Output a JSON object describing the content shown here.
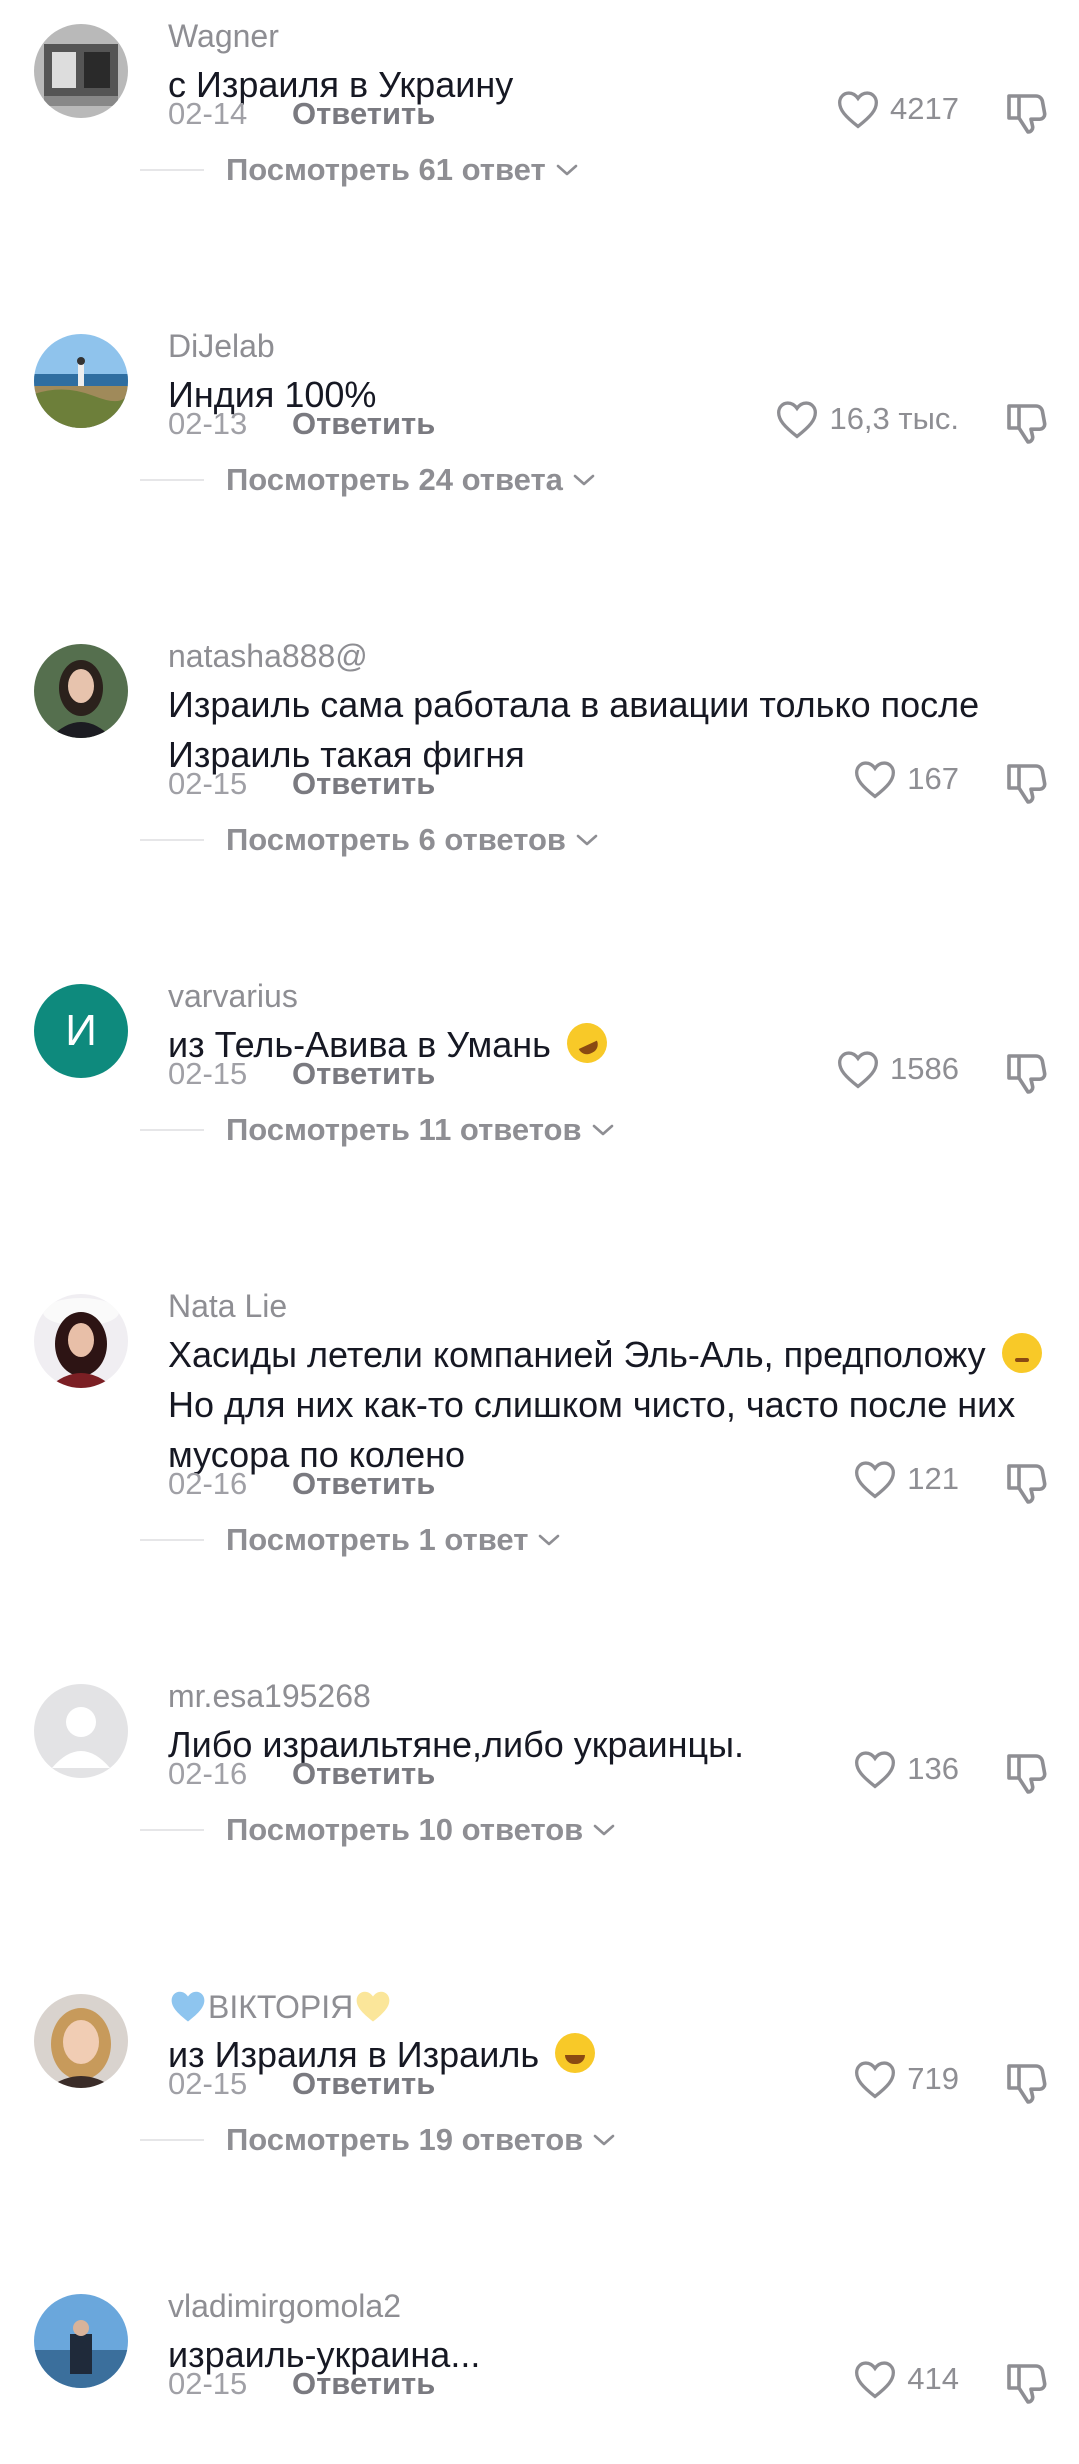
{
  "comments": [
    {
      "username": "Wagner",
      "text": "с Израиля в Украину",
      "date": "02-14",
      "reply_label": "Ответить",
      "likes": "4217",
      "view_replies": "Посмотреть 61 ответ"
    },
    {
      "username": "DiJelab",
      "text": "Индия 100%",
      "date": "02-13",
      "reply_label": "Ответить",
      "likes": "16,3 тыс.",
      "view_replies": "Посмотреть 24 ответа"
    },
    {
      "username": "natasha888@",
      "text": "Израиль сама работала в авиации только после Израиль такая фигня",
      "date": "02-15",
      "reply_label": "Ответить",
      "likes": "167",
      "view_replies": "Посмотреть 6 ответов"
    },
    {
      "username": "varvarius",
      "avatar_letter": "И",
      "text": "из Тель-Авива в Умань",
      "date": "02-15",
      "reply_label": "Ответить",
      "likes": "1586",
      "view_replies": "Посмотреть 11 ответов"
    },
    {
      "username": "Nata Lie",
      "text": "Хасиды летели компанией Эль-Аль, предположу",
      "text2": "Но для них как-то слишком чисто, часто после них мусора по колено",
      "date": "02-16",
      "reply_label": "Ответить",
      "likes": "121",
      "view_replies": "Посмотреть 1 ответ"
    },
    {
      "username": "mr.esa195268",
      "text": "Либо израильтяне,либо украинцы.",
      "date": "02-16",
      "reply_label": "Ответить",
      "likes": "136",
      "view_replies": "Посмотреть 10 ответов"
    },
    {
      "username": "ВIКТОРIЯ",
      "text": "из Израиля в Израиль",
      "date": "02-15",
      "reply_label": "Ответить",
      "likes": "719",
      "view_replies": "Посмотреть 19 ответов"
    },
    {
      "username": "vladimirgomola2",
      "text": "израиль-украина...",
      "date": "02-15",
      "reply_label": "Ответить",
      "likes": "414"
    }
  ],
  "colors": {
    "username": "#8e8e93",
    "text": "#161823",
    "meta": "#a0a0a6",
    "letter_avatar_bg": "#0e8a7d"
  }
}
